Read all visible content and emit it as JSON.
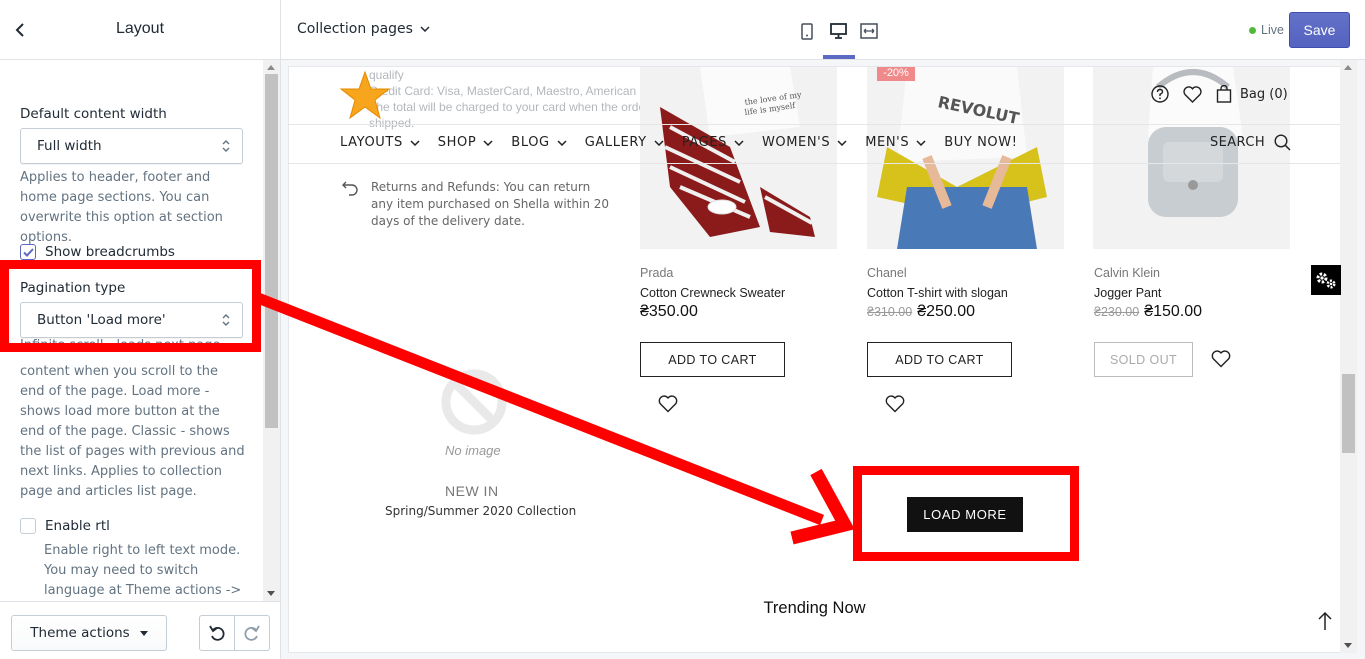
{
  "editor": {
    "panel_title": "Layout",
    "content_width": {
      "label": "Default content width",
      "value": "Full width",
      "help": "Applies to header, footer and home page sections. You can overwrite this option at section options."
    },
    "breadcrumbs": {
      "label": "Show breadcrumbs",
      "checked": true
    },
    "pagination": {
      "label": "Pagination type",
      "value": "Button 'Load more'",
      "help_partial": "Infinite scroll - loads next page",
      "help": "content when you scroll to the end of the page. Load more - shows load more button at the end of the page. Classic - shows the list of pages with previous and next links. Applies to collection page and articles list page."
    },
    "rtl": {
      "label": "Enable rtl",
      "checked": false,
      "help": "Enable right to left text mode. You may need to switch language at Theme actions ->"
    },
    "footer": {
      "theme_actions": "Theme actions"
    }
  },
  "topbar": {
    "page_selector": "Collection pages",
    "live_label": "Live",
    "save_label": "Save",
    "active_device": "desktop"
  },
  "store": {
    "faded_info": "qualify\nCredit Card: Visa, MasterCard, Maestro, American Express. The total will be charged to your card when the order is shipped.",
    "nav": [
      "LAYOUTS",
      "SHOP",
      "BLOG",
      "GALLERY",
      "PAGES",
      "WOMEN'S",
      "MEN'S",
      "BUY NOW!"
    ],
    "nav_dropdowns": [
      true,
      true,
      true,
      true,
      true,
      true,
      true,
      false
    ],
    "search_label": "SEARCH",
    "bag_label": "Bag (0)",
    "returns_text": "Returns and Refunds: You can return any item purchased on Shella within 20 days of the delivery date.",
    "no_image_label": "No image",
    "promo_title": "NEW IN",
    "promo_subtitle": "Spring/Summer 2020 Collection",
    "products": [
      {
        "brand": "Prada",
        "title": "Cotton Crewneck Sweater",
        "price": "₴350.00",
        "old_price": "",
        "button": "ADD TO CART",
        "sold_out": false,
        "badge": ""
      },
      {
        "brand": "Chanel",
        "title": "Cotton T-shirt with slogan",
        "price": "₴250.00",
        "old_price": "₴310.00",
        "button": "ADD TO CART",
        "sold_out": false,
        "badge": "-20%"
      },
      {
        "brand": "Calvin Klein",
        "title": "Jogger Pant",
        "price": "₴150.00",
        "old_price": "₴230.00",
        "button": "SOLD OUT",
        "sold_out": true,
        "badge": ""
      }
    ],
    "load_more_label": "LOAD MORE",
    "trending_title": "Trending Now"
  },
  "colors": {
    "accent": "#5c6ac4",
    "annotation": "#ff0000",
    "live": "#50b83c"
  }
}
